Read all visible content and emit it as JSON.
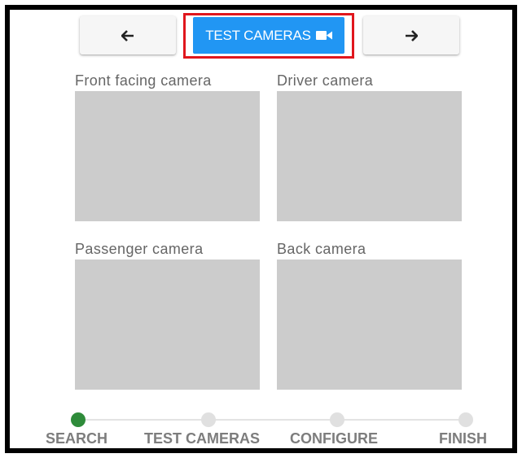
{
  "toolbar": {
    "prev_icon": "arrow-left-icon",
    "next_icon": "arrow-right-icon",
    "test_button_label": "TEST CAMERAS",
    "test_button_icon": "video-camera-icon",
    "accent_color": "#2196f3",
    "highlight_color": "#e0161d"
  },
  "cameras": [
    {
      "label": "Front facing camera"
    },
    {
      "label": "Driver camera"
    },
    {
      "label": "Passenger camera"
    },
    {
      "label": "Back camera"
    }
  ],
  "stepper": {
    "active_color": "#2e8b3a",
    "steps": [
      {
        "label": "SEARCH",
        "active": true
      },
      {
        "label": "TEST CAMERAS",
        "active": false
      },
      {
        "label": "CONFIGURE",
        "active": false
      },
      {
        "label": "FINISH",
        "active": false
      }
    ]
  }
}
